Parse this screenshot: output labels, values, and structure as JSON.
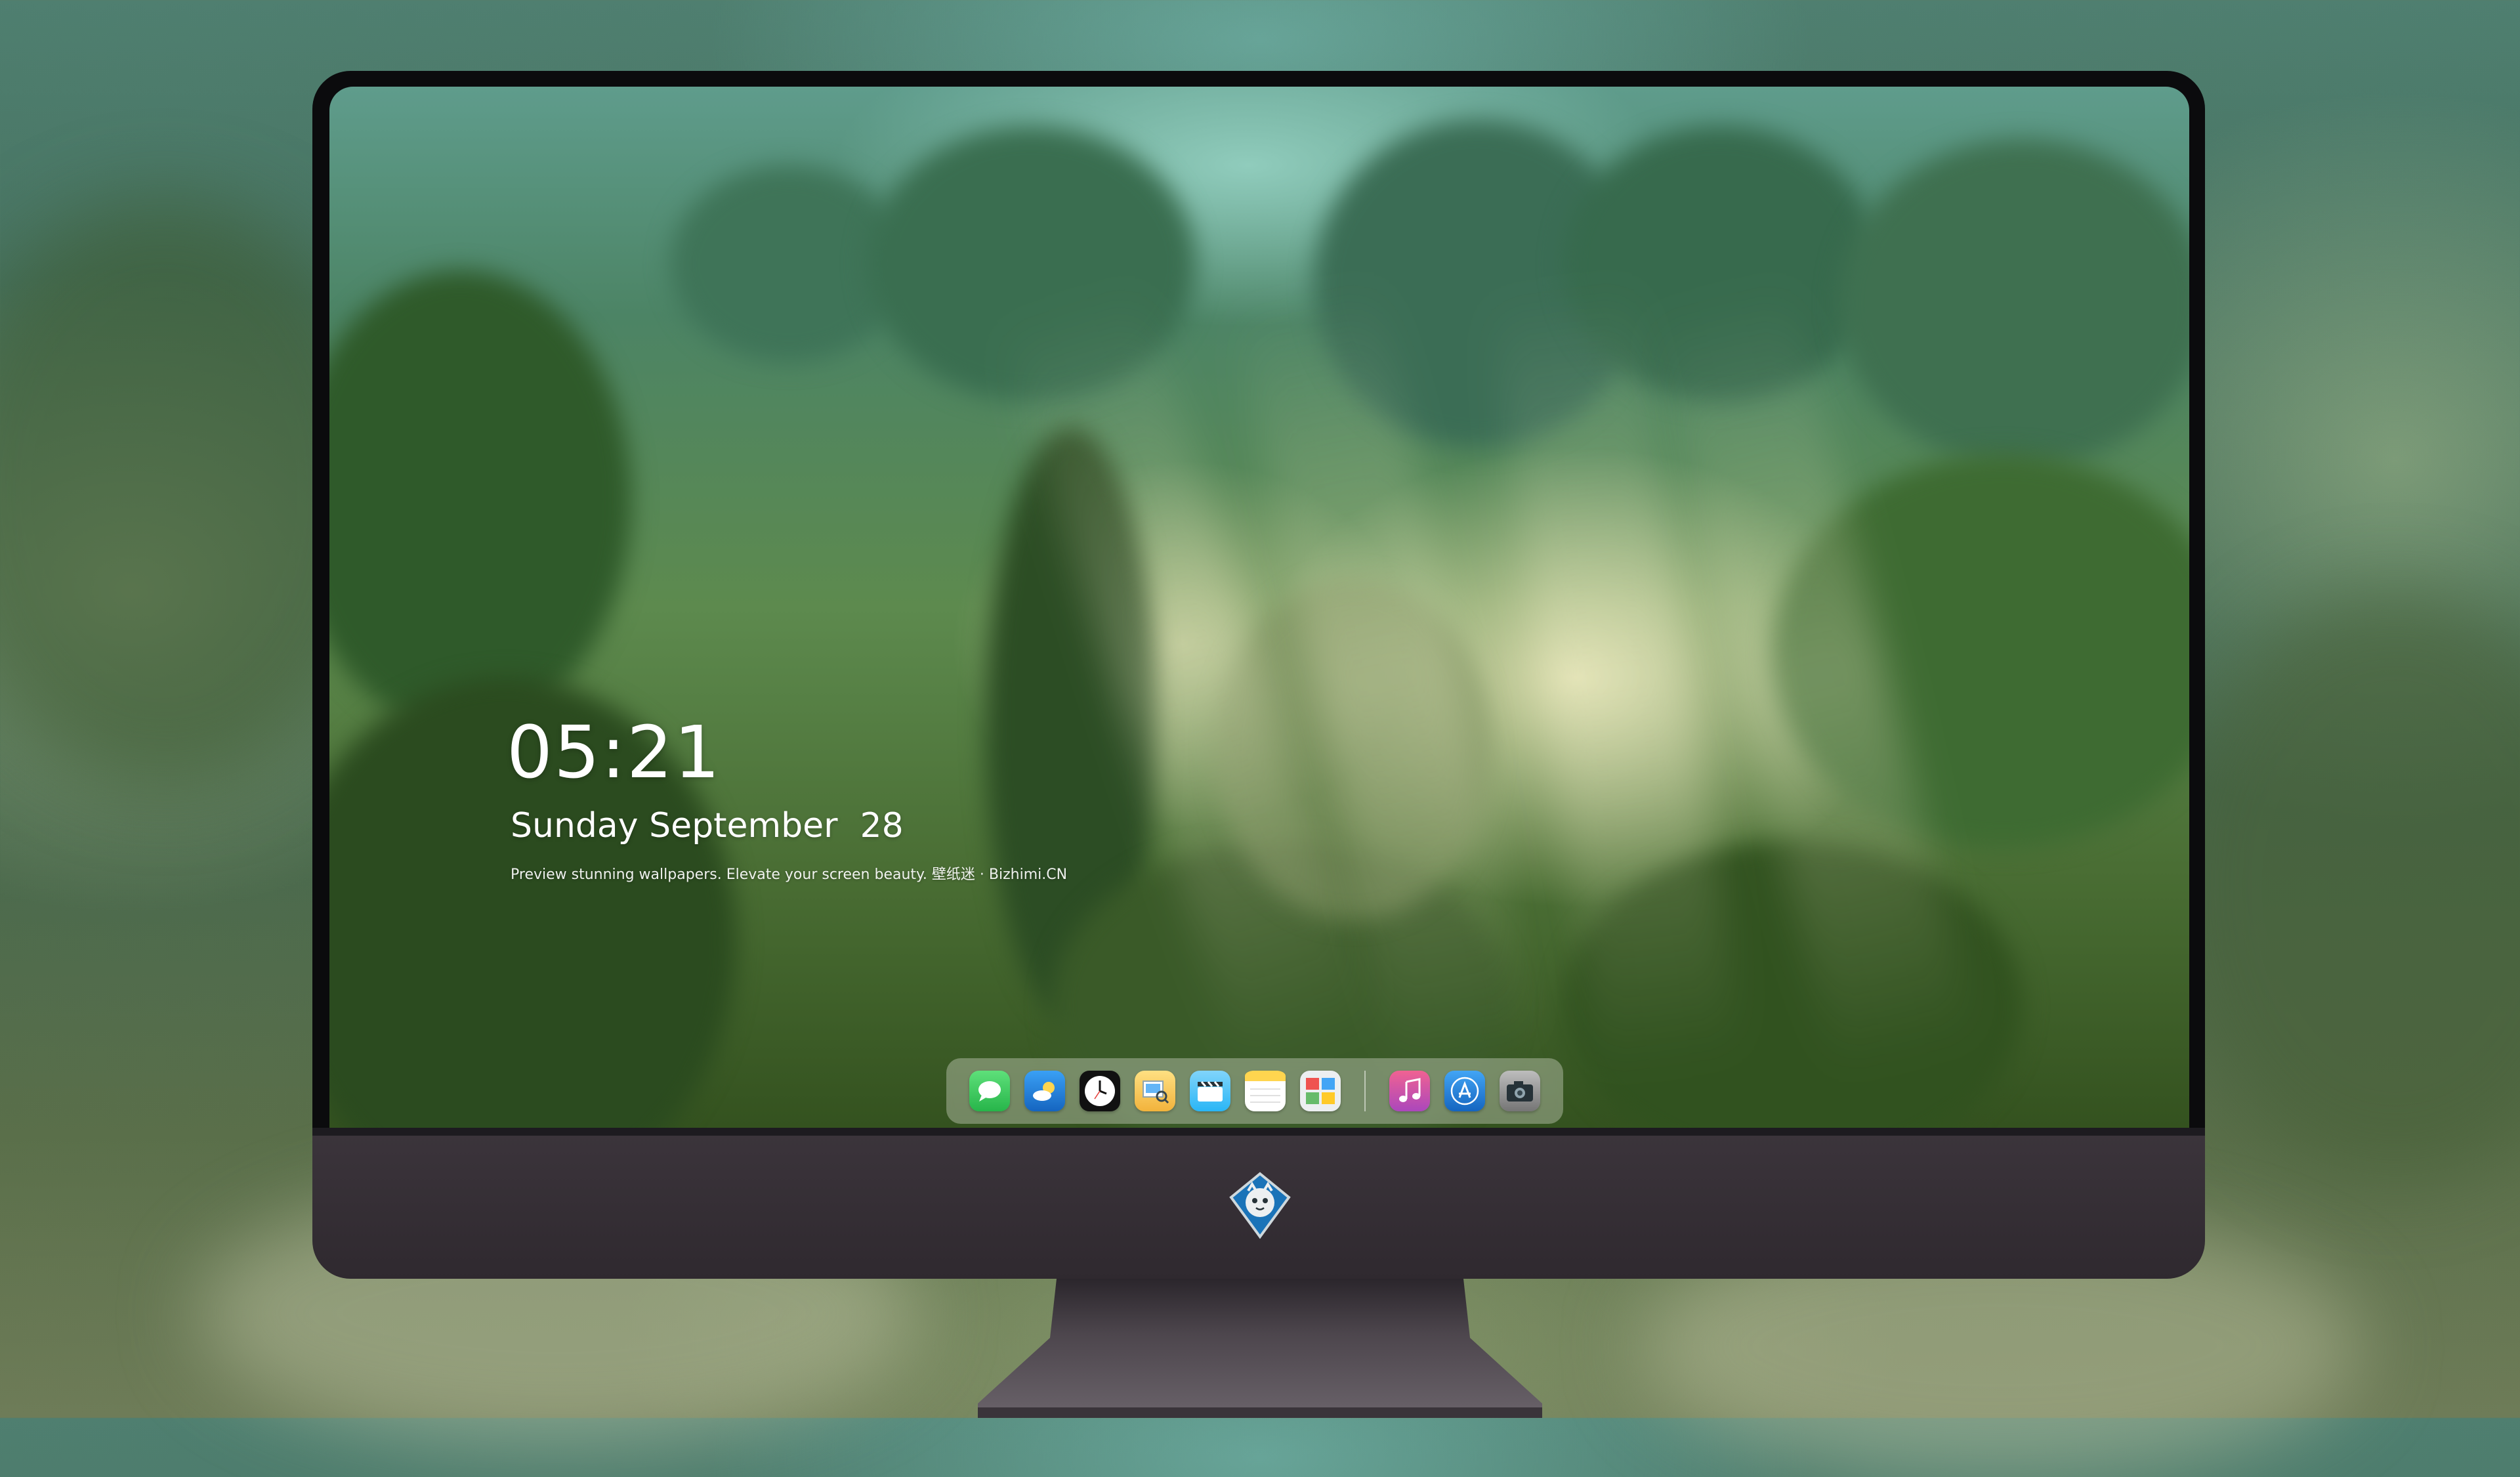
{
  "lock_screen": {
    "time": "05:21",
    "weekday_month": "Sunday September",
    "day": "28",
    "tagline": "Preview stunning wallpapers. Elevate your screen beauty. 壁纸迷 · Bizhimi.CN"
  },
  "dock": {
    "apps": [
      {
        "name": "messages-icon",
        "color": "#34c759"
      },
      {
        "name": "weather-icon",
        "color": "#1e88e5"
      },
      {
        "name": "clock-icon",
        "color": "#111111"
      },
      {
        "name": "preview-icon",
        "color": "#f2c94c"
      },
      {
        "name": "clips-icon",
        "color": "#4fc3f7"
      },
      {
        "name": "notes-icon",
        "color": "#ffd54f"
      },
      {
        "name": "photo-booth-icon",
        "color": "#e0e0e0"
      },
      {
        "name": "music-icon",
        "color": "#e040fb"
      },
      {
        "name": "app-store-icon",
        "color": "#1e88e5"
      },
      {
        "name": "camera-icon",
        "color": "#9e9e9e"
      }
    ]
  },
  "colors": {
    "bezel": "#0b0b0d",
    "chin": "#3b343b",
    "stand": "#4a424a"
  }
}
